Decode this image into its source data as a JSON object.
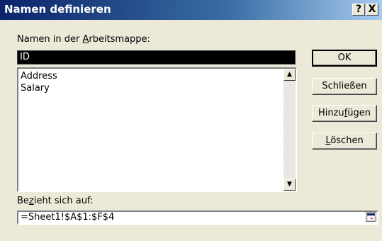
{
  "window": {
    "title": "Namen definieren",
    "help_label": "?",
    "close_label": "X"
  },
  "names_label": {
    "before": "Namen in der ",
    "accel": "A",
    "after": "rbeitsmappe:"
  },
  "name_input": {
    "value": "ID"
  },
  "names_list": {
    "items": [
      "Address",
      "Salary"
    ],
    "scroll_up_glyph": "▲",
    "scroll_down_glyph": "▼"
  },
  "buttons": {
    "ok": "OK",
    "close": "Schließen",
    "add": {
      "before": "Hinzu",
      "accel": "f",
      "after": "ügen"
    },
    "delete": {
      "before": "",
      "accel": "L",
      "after": "öschen"
    }
  },
  "refers_label": {
    "before": "Be",
    "accel": "z",
    "after": "ieht sich auf:"
  },
  "refers_input": {
    "value": "=Sheet1!$A$1:$F$4"
  },
  "icons": {
    "collapse": "collapse-dialog-icon"
  },
  "colors": {
    "title_start": "#0a246a",
    "title_end": "#a6caf0",
    "dialog_bg": "#ece9d8",
    "selected_bg": "#000000"
  }
}
